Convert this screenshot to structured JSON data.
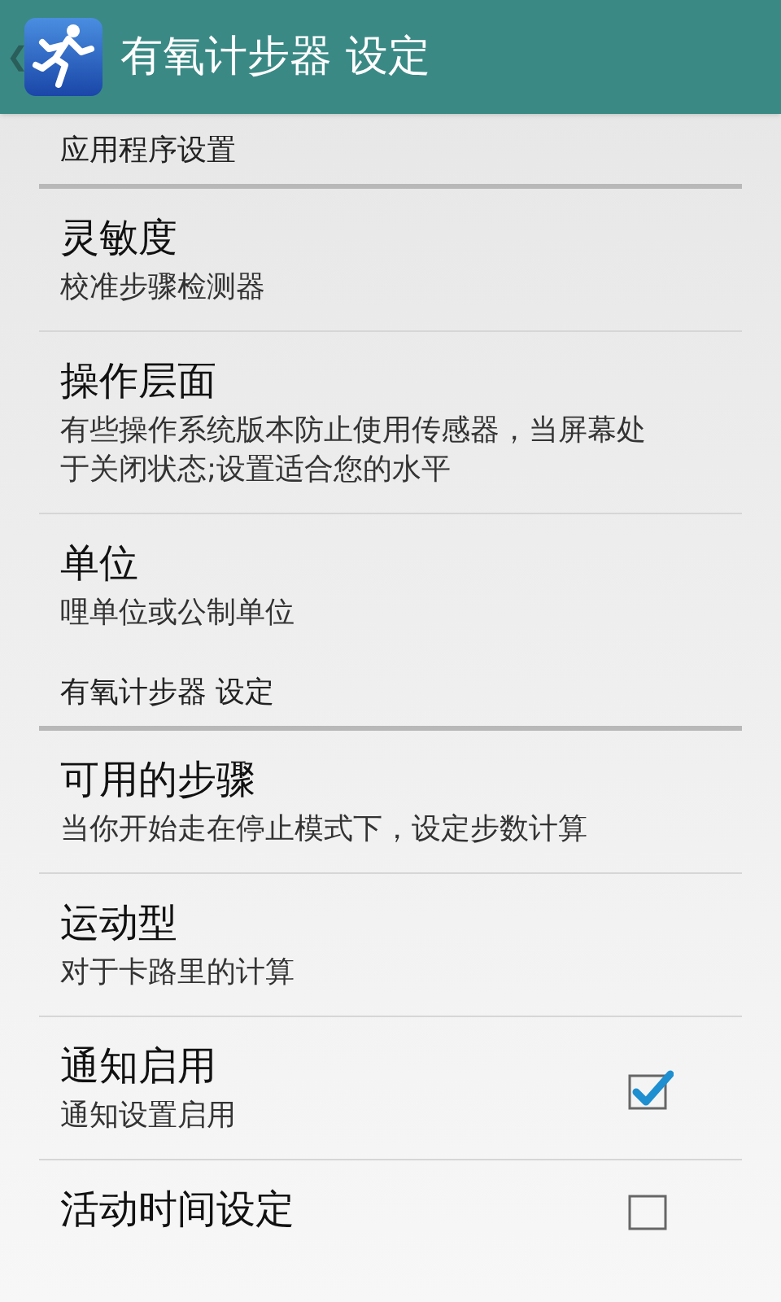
{
  "action_bar": {
    "back": "❮",
    "title": "有氧计步器 设定"
  },
  "sections": [
    {
      "title": "应用程序设置",
      "items": [
        {
          "kind": "plain",
          "title": "灵敏度",
          "summary": "校准步骤检测器"
        },
        {
          "kind": "plain",
          "title": "操作层面",
          "summary": "有些操作系统版本防止使用传感器，当屏幕处于关闭状态;设置适合您的水平"
        },
        {
          "kind": "plain",
          "title": "单位",
          "summary": "哩单位或公制单位"
        }
      ]
    },
    {
      "title": "有氧计步器 设定",
      "items": [
        {
          "kind": "plain",
          "title": "可用的步骤",
          "summary": "当你开始走在停止模式下，设定步数计算"
        },
        {
          "kind": "plain",
          "title": "运动型",
          "summary": "对于卡路里的计算"
        },
        {
          "kind": "checkbox",
          "title": "通知启用",
          "summary": "通知设置启用",
          "checked": true
        },
        {
          "kind": "checkbox",
          "title": "活动时间设定",
          "checked": false
        }
      ]
    }
  ]
}
